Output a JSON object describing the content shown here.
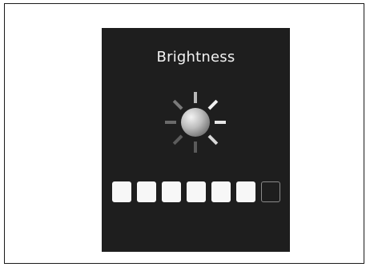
{
  "screen": {
    "title": "Brightness",
    "icon": "sun-icon",
    "background": "#1e1e1e"
  },
  "brightness": {
    "level": 6,
    "max": 7
  }
}
